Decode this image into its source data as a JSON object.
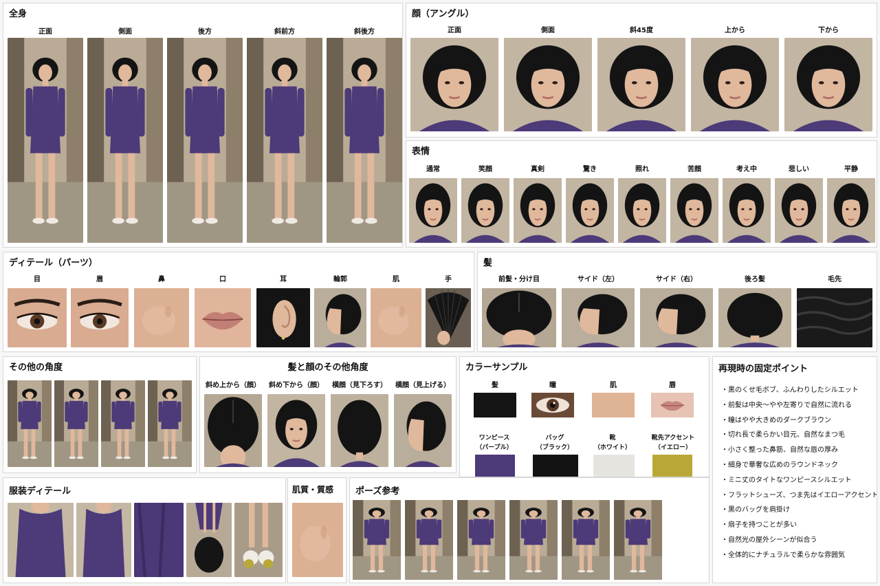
{
  "full_body": {
    "title": "全身",
    "labels": [
      "正面",
      "側面",
      "後方",
      "斜前方",
      "斜後方"
    ]
  },
  "face_angle": {
    "title": "顔（アングル）",
    "labels": [
      "正面",
      "側面",
      "斜45度",
      "上から",
      "下から"
    ]
  },
  "expression": {
    "title": "表情",
    "labels": [
      "通常",
      "笑顔",
      "真剣",
      "驚き",
      "照れ",
      "苦顔",
      "考え中",
      "悲しい",
      "平静"
    ]
  },
  "detail_parts": {
    "title": "ディテール（パーツ）",
    "labels": [
      "目",
      "眉",
      "鼻",
      "口",
      "耳",
      "輪郭",
      "肌",
      "手"
    ]
  },
  "hair": {
    "title": "髪",
    "labels": [
      "前髪・分け目",
      "サイド（左）",
      "サイド（右）",
      "後ろ髪",
      "毛先"
    ]
  },
  "other_angles": {
    "title": "その他の角度"
  },
  "hair_face_angles": {
    "title": "髪と顔のその他角度",
    "labels": [
      "斜め上から（顔）",
      "斜め下から（顔）",
      "横顔（見下ろす）",
      "横顔（見上げる）"
    ]
  },
  "color_samples": {
    "title": "カラーサンプル",
    "row1": [
      {
        "label": "髪",
        "color": "#141414"
      },
      {
        "label": "瞳",
        "color": "#6a4a36"
      },
      {
        "label": "肌",
        "color": "#dfb496"
      },
      {
        "label": "唇",
        "color": "#d7a39a"
      }
    ],
    "row2": [
      {
        "label1": "ワンピース",
        "label2": "（パープル）",
        "color": "#4d3a78"
      },
      {
        "label1": "バッグ",
        "label2": "（ブラック）",
        "color": "#131313"
      },
      {
        "label1": "靴",
        "label2": "（ホワイト）",
        "color": "#e6e4df"
      },
      {
        "label1": "靴先アクセント",
        "label2": "（イエロー）",
        "color": "#b9a838"
      }
    ]
  },
  "fixed_points": {
    "title": "再現時の固定ポイント",
    "items": [
      "・黒のくせ毛ボブ、ふんわりしたシルエット",
      "・前髪は中央〜やや左寄りで自然に流れる",
      "・瞳はやや大きめのダークブラウン",
      "・切れ長で柔らかい目元、自然なまつ毛",
      "・小さく整った鼻筋、自然な唇の厚み",
      "・細身で華奢な広めのラウンドネック",
      "・ミニ丈のタイトなワンピースシルエット",
      "・フラットシューズ、つま先はイエローアクセント",
      "・黒のバッグを肩掛け",
      "・扇子を持つことが多い",
      "・自然光の屋外シーンが似合う",
      "・全体的にナチュラルで柔らかな雰囲気"
    ]
  },
  "outfit_detail": {
    "title": "服装ディテール"
  },
  "skin_texture": {
    "title": "肌質・質感"
  },
  "pose_reference": {
    "title": "ポーズ参考"
  },
  "palette": {
    "hair": "#141414",
    "dress": "#4d3a78",
    "skin": "#e0b89c",
    "wall": "#b9ab96",
    "street": "#a09684"
  }
}
